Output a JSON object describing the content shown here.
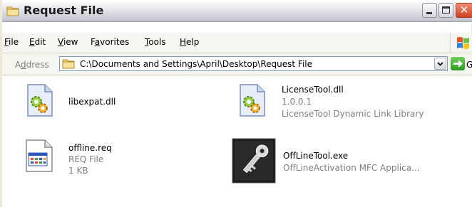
{
  "window": {
    "title": "Request File",
    "controls": {
      "minimize": "_",
      "maximize": "□",
      "close": "✕"
    }
  },
  "menubar": {
    "items": [
      {
        "label": "File"
      },
      {
        "label": "Edit"
      },
      {
        "label": "View"
      },
      {
        "label": "Favorites"
      },
      {
        "label": "Tools"
      },
      {
        "label": "Help"
      }
    ],
    "logo_icon": "windows-flag-icon"
  },
  "addressbar": {
    "label": "Address",
    "path": "C:\\Documents and Settings\\April\\Desktop\\Request File",
    "go_label": "Go"
  },
  "files": [
    {
      "name": "libexpat.dll",
      "icon": "dll-gear-icon",
      "details": []
    },
    {
      "name": "LicenseTool.dll",
      "icon": "dll-gear-icon",
      "details": [
        "1.0.0.1",
        "LicenseTool Dynamic Link Library"
      ]
    },
    {
      "name": "offline.req",
      "icon": "req-file-icon",
      "details": [
        "REQ File",
        "1 KB"
      ]
    },
    {
      "name": "OffLineTool.exe",
      "icon": "key-app-icon",
      "details": [
        "OffLineActivation MFC Applica..."
      ]
    }
  ],
  "colors": {
    "title_text": "#1c1c1c",
    "meta_text": "#7f7f7f",
    "close_button": "#cf4321",
    "go_button": "#2c9a24"
  }
}
